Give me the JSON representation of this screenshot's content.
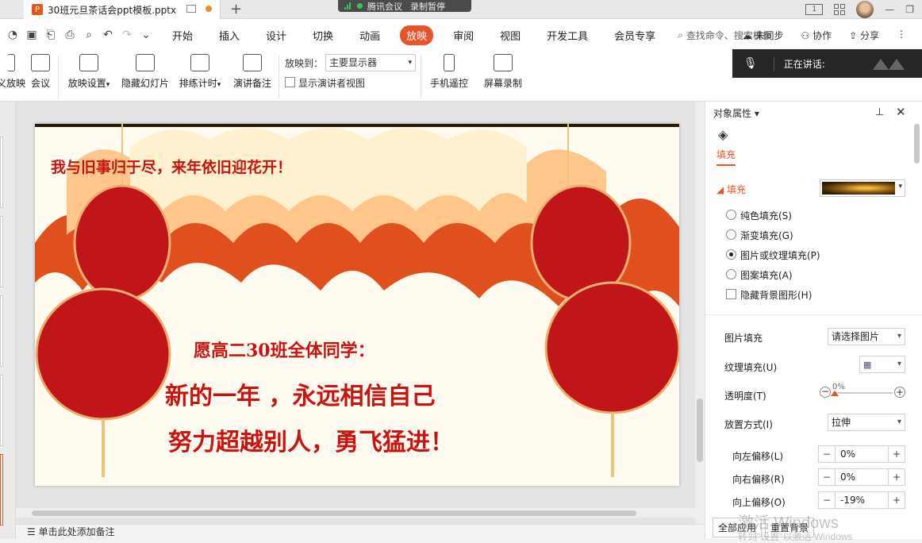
{
  "titlebar": {
    "doc_title": "30班元旦茶话会ppt模板.pptx",
    "meeting_app": "腾讯会议",
    "meeting_status": "录制暂停"
  },
  "menu": {
    "items": [
      "开始",
      "插入",
      "设计",
      "切换",
      "动画",
      "放映",
      "审阅",
      "视图",
      "开发工具",
      "会员专享"
    ],
    "active": "放映",
    "search_placeholder": "查找命令、搜索模板",
    "unsynced": "未同步",
    "collaborate": "协作",
    "share": "分享"
  },
  "ribbon": {
    "custom_show": "义放映",
    "meeting": "会议",
    "show_settings": "放映设置",
    "hide_slide": "隐藏幻灯片",
    "rehearse": "排练计时",
    "speaker_notes": "演讲备注",
    "play_to_label": "放映到：",
    "play_to_value": "主要显示器",
    "presenter_view": "显示演讲者视图",
    "phone_remote": "手机遥控",
    "screen_record": "屏幕录制",
    "speaking": "正在讲话:"
  },
  "slide": {
    "motto": "我与旧事归于尽，来年依旧迎花开！",
    "greeting": "愿高二30班全体同学：",
    "line1": "新的一年 ，永远相信自己",
    "line2": "努力超越别人，勇飞猛进！"
  },
  "notes": {
    "placeholder": "单击此处添加备注"
  },
  "panel": {
    "title": "对象属性",
    "tab_fill": "填充",
    "section_fill": "填充",
    "options": [
      "纯色填充(S)",
      "渐变填充(G)",
      "图片或纹理填充(P)",
      "图案填充(A)"
    ],
    "selected_option": "图片或纹理填充(P)",
    "hide_bg": "隐藏背景图形(H)",
    "picture_fill_label": "图片填充",
    "picture_fill_value": "请选择图片",
    "texture_fill_label": "纹理填充(U)",
    "transparency_label": "透明度(T)",
    "transparency_value": "0%",
    "placement_label": "放置方式(I)",
    "placement_value": "拉伸",
    "offset_left_label": "向左偏移(L)",
    "offset_left_value": "0%",
    "offset_right_label": "向右偏移(R)",
    "offset_right_value": "0%",
    "offset_up_label": "向上偏移(O)",
    "offset_up_value": "-19%",
    "apply_all": "全部应用",
    "reset_bg": "重置背景",
    "watermark": "激活 Windows",
    "watermark_sub": "转到\"设置\"以激活 Windows"
  },
  "colors": {
    "accent": "#e8542a",
    "slide_text": "#c8140e",
    "lantern": "#c0161a"
  }
}
